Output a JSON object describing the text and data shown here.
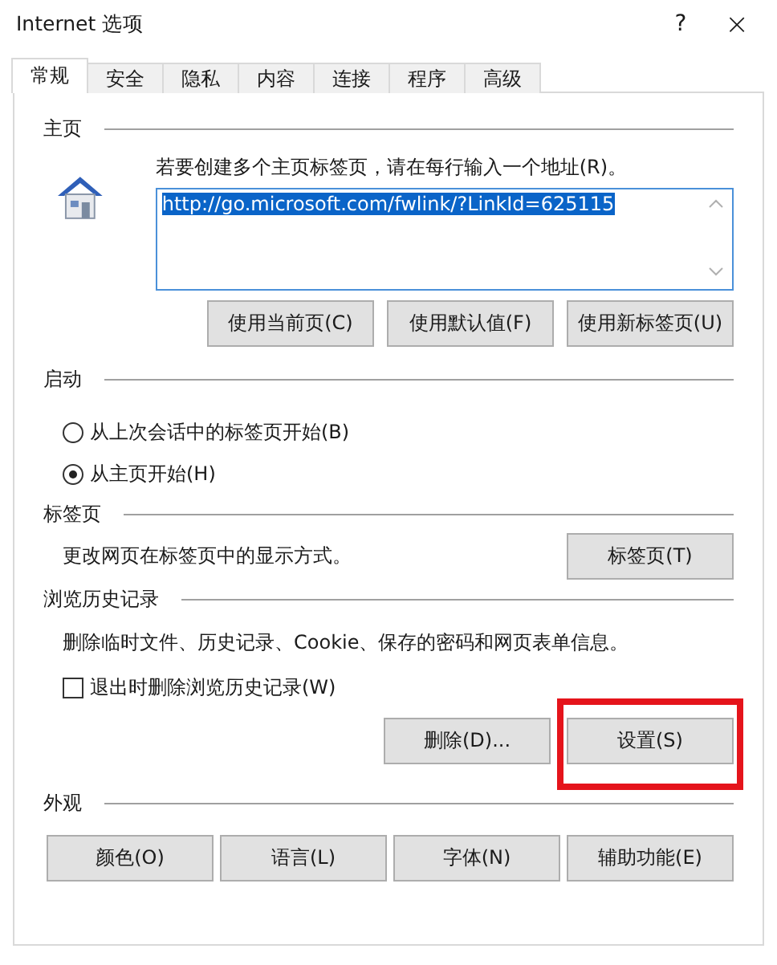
{
  "window": {
    "title": "Internet 选项",
    "help": "?",
    "close": "×"
  },
  "tabs": [
    {
      "label": "常规",
      "selected": true
    },
    {
      "label": "安全",
      "selected": false
    },
    {
      "label": "隐私",
      "selected": false
    },
    {
      "label": "内容",
      "selected": false
    },
    {
      "label": "连接",
      "selected": false
    },
    {
      "label": "程序",
      "selected": false
    },
    {
      "label": "高级",
      "selected": false
    }
  ],
  "home": {
    "title": "主页",
    "hint": "若要创建多个主页标签页，请在每行输入一个地址(R)。",
    "value": "http://go.microsoft.com/fwlink/?LinkId=625115",
    "buttons": [
      {
        "label": "使用当前页(C)"
      },
      {
        "label": "使用默认值(F)"
      },
      {
        "label": "使用新标签页(U)"
      }
    ]
  },
  "startup": {
    "title": "启动",
    "options": [
      {
        "label": "从上次会话中的标签页开始(B)",
        "selected": false
      },
      {
        "label": "从主页开始(H)",
        "selected": true
      }
    ]
  },
  "tabs_section": {
    "title": "标签页",
    "text": "更改网页在标签页中的显示方式。",
    "button": "标签页(T)"
  },
  "history": {
    "title": "浏览历史记录",
    "text": "删除临时文件、历史记录、Cookie、保存的密码和网页表单信息。",
    "checkbox": {
      "label": "退出时删除浏览历史记录(W)",
      "checked": false
    },
    "buttons": [
      {
        "label": "删除(D)...",
        "highlighted": false
      },
      {
        "label": "设置(S)",
        "highlighted": true
      }
    ]
  },
  "appearance": {
    "title": "外观",
    "buttons": [
      {
        "label": "颜色(O)"
      },
      {
        "label": "语言(L)"
      },
      {
        "label": "字体(N)"
      },
      {
        "label": "辅助功能(E)"
      }
    ]
  }
}
